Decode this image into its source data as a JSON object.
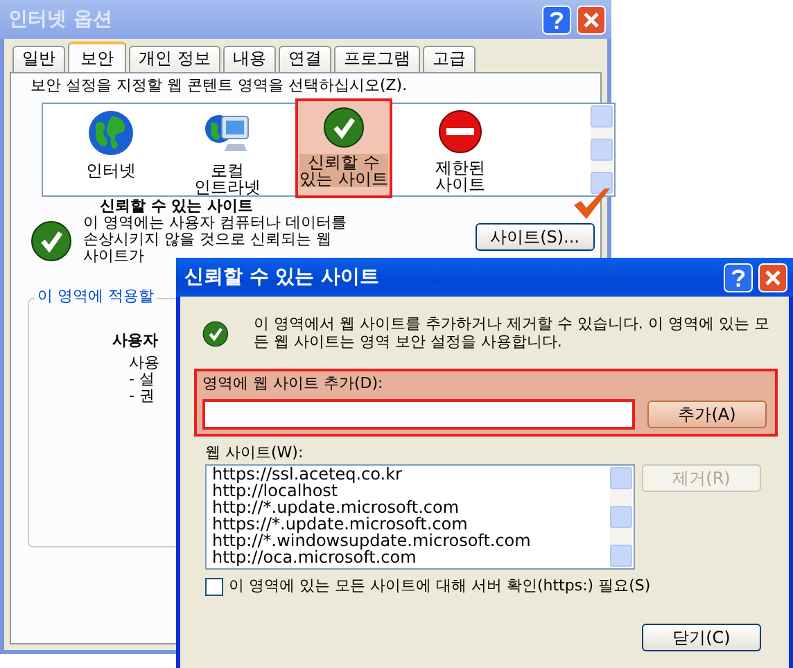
{
  "background_window": {
    "title": "인터넷 옵션",
    "tabs": [
      {
        "label": "일반",
        "selected": false
      },
      {
        "label": "보안",
        "selected": true
      },
      {
        "label": "개인 정보",
        "selected": false
      },
      {
        "label": "내용",
        "selected": false
      },
      {
        "label": "연결",
        "selected": false
      },
      {
        "label": "프로그램",
        "selected": false
      },
      {
        "label": "고급",
        "selected": false
      }
    ],
    "instruction": "보안 설정을 지정할 웹 콘텐트 영역을 선택하십시오(Z).",
    "zones": [
      {
        "kind": "internet",
        "label_lines": [
          "인터넷"
        ],
        "selected": false
      },
      {
        "kind": "intranet",
        "label_lines": [
          "로컬",
          "인트라넷"
        ],
        "selected": false
      },
      {
        "kind": "trusted",
        "label_lines": [
          "신뢰할 수",
          "있는 사이트"
        ],
        "selected": true
      },
      {
        "kind": "restricted",
        "label_lines": [
          "제한된",
          "사이트"
        ],
        "selected": false
      }
    ],
    "zone_heading": "신뢰할 수 있는 사이트",
    "zone_description": [
      "이 영역에는 사용자 컴퓨터나 데이터를",
      "손상시키지 않을 것으로 신뢰되는 웹",
      "사이트가"
    ],
    "sites_button": "사이트(S)...",
    "group_legend": "이 영역에 적용할",
    "group_heading": "사용자",
    "group_lines": [
      "사용",
      "- 설",
      "- 권"
    ]
  },
  "dialog": {
    "title": "신뢰할 수 있는 사이트",
    "description": "이 영역에서 웹 사이트를 추가하거나 제거할 수 있습니다. 이 영역에 있는 모든 웹 사이트는 영역 보안 설정을 사용합니다.",
    "add_label": "영역에 웹 사이트 추가(D):",
    "add_button": "추가(A)",
    "list_label": "웹 사이트(W):",
    "sites": [
      "https://ssl.aceteq.co.kr",
      "http://localhost",
      "http://*.update.microsoft.com",
      "https://*.update.microsoft.com",
      "http://*.windowsupdate.microsoft.com",
      "http://oca.microsoft.com"
    ],
    "remove_button": {
      "label": "제거(R)",
      "disabled": true
    },
    "require_https": {
      "label": "이 영역에 있는 모든 사이트에 대해 서버 확인(https:) 필요(S)",
      "checked": false
    },
    "close_button": "닫기(C)"
  }
}
